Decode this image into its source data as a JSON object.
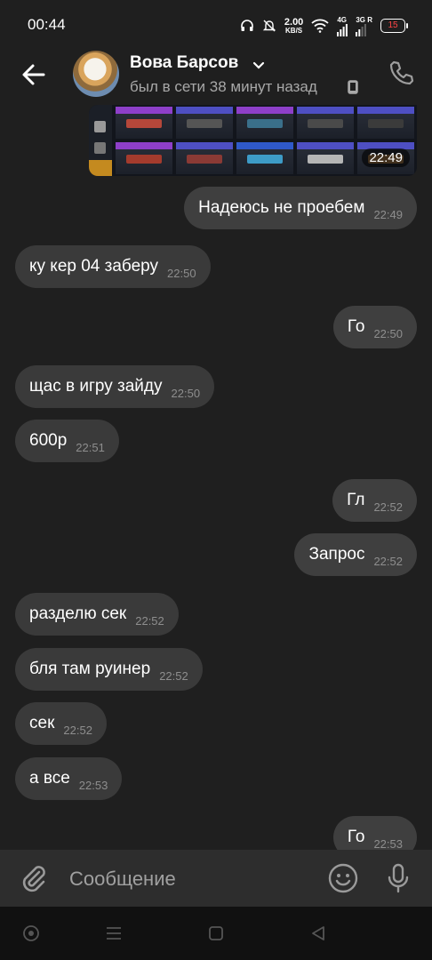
{
  "status_bar": {
    "time": "00:44",
    "speed_value": "2.00",
    "speed_unit": "KB/S",
    "net_1": "4G",
    "net_2": "3G",
    "net_2_sub": "R",
    "battery": "15"
  },
  "header": {
    "contact_name": "Вова Барсов",
    "status": "был в сети 38 минут назад"
  },
  "image_message": {
    "time": "22:49"
  },
  "messages": [
    {
      "text": "Надеюсь не проебем",
      "time": "22:49",
      "dir": "out"
    },
    {
      "text": "ку кер 04 заберу",
      "time": "22:50",
      "dir": "in"
    },
    {
      "text": "Го",
      "time": "22:50",
      "dir": "out"
    },
    {
      "text": "щас в игру зайду",
      "time": "22:50",
      "dir": "in"
    },
    {
      "text": "600р",
      "time": "22:51",
      "dir": "in"
    },
    {
      "text": "Гл",
      "time": "22:52",
      "dir": "out"
    },
    {
      "text": "Запрос",
      "time": "22:52",
      "dir": "out"
    },
    {
      "text": "разделю сек",
      "time": "22:52",
      "dir": "in"
    },
    {
      "text": "бля там руинер",
      "time": "22:52",
      "dir": "in"
    },
    {
      "text": "сек",
      "time": "22:52",
      "dir": "in"
    },
    {
      "text": "а все",
      "time": "22:53",
      "dir": "in"
    },
    {
      "text": "Го",
      "time": "22:53",
      "dir": "out"
    }
  ],
  "composer": {
    "placeholder": "Сообщение"
  },
  "colors": {
    "background": "#1f1f1f",
    "bubble": "#3a3a3a",
    "composer": "#2d2d2d",
    "navbar": "#111111"
  }
}
